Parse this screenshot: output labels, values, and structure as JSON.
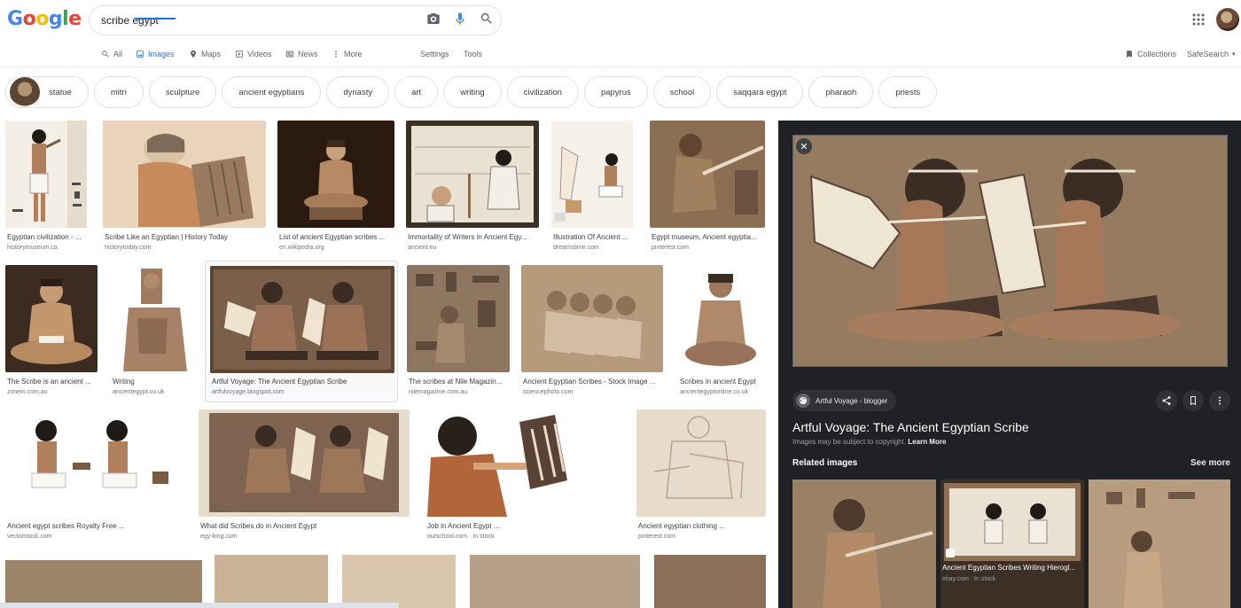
{
  "logo": "Google",
  "search": {
    "query": "scribe egypt"
  },
  "tabs": {
    "all": "All",
    "images": "Images",
    "maps": "Maps",
    "videos": "Videos",
    "news": "News",
    "more": "More",
    "settings": "Settings",
    "tools": "Tools"
  },
  "header_right": {
    "collections": "Collections",
    "safesearch": "SafeSearch"
  },
  "chips": [
    "statue",
    "mitri",
    "sculpture",
    "ancient egyptians",
    "dynasty",
    "art",
    "writing",
    "civilization",
    "papyrus",
    "school",
    "saqqara egypt",
    "pharaoh",
    "priests"
  ],
  "results": [
    {
      "title": "Egyptian civilization - ...",
      "source": "historymuseum.ca"
    },
    {
      "title": "Scribe Like an Egyptian | History Today",
      "source": "historytoday.com"
    },
    {
      "title": "List of ancient Egyptian scribes ...",
      "source": "en.wikipedia.org"
    },
    {
      "title": "Immortality of Writers in Ancient Egy...",
      "source": "ancient.eu"
    },
    {
      "title": "Illustration Of Ancient ...",
      "source": "dreamstime.com"
    },
    {
      "title": "Egypt museum, Ancient egyptia...",
      "source": "pinterest.com"
    },
    {
      "title": "The Scribe is an ancient ...",
      "source": "zonein.com.au"
    },
    {
      "title": "Writing",
      "source": "ancientegypt.co.uk"
    },
    {
      "title": "Artful Voyage: The Ancient Egyptian Scribe",
      "source": "artfulvoyage.blogspot.com"
    },
    {
      "title": "The scribes at Nile Magazin...",
      "source": "nilemagazine.com.au"
    },
    {
      "title": "Ancient Egyptian Scribes - Stock Image ...",
      "source": "sciencephoto.com"
    },
    {
      "title": "Scribes in ancient Egypt",
      "source": "ancientegyptonline.co.uk"
    },
    {
      "title": "Ancient egypt scribes Royalty Free ...",
      "source": "vectorstock.com"
    },
    {
      "title": "What did Scribes do in Ancient Egypt",
      "source": "egy-king.com"
    },
    {
      "title": "Job in Ancient Egypt ...",
      "source": "outschool.com · In stock"
    },
    {
      "title": "Ancient egyptian clothing ...",
      "source": "pinterest.com"
    }
  ],
  "panel": {
    "site": "Artful Voyage - blogger",
    "title": "Artful Voyage: The Ancient Egyptian Scribe",
    "copyright": "Images may be subject to copyright.",
    "learn_more": "Learn More",
    "related_heading": "Related images",
    "see_more": "See more",
    "related": [
      {
        "title": "Ancient Egyptian Scribes Writing Hierogl...",
        "source": "ebay.com · In stock"
      }
    ]
  },
  "colors": {
    "accent": "#1a73e8",
    "panel_bg": "#202124"
  }
}
